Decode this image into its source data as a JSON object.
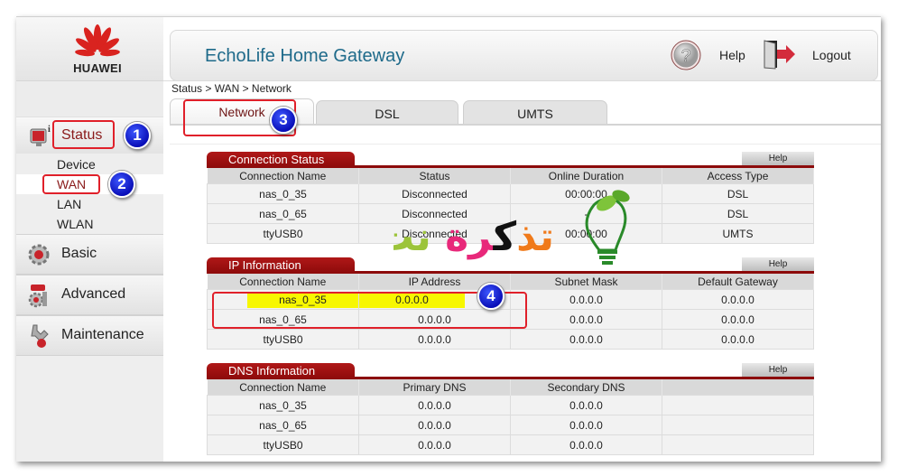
{
  "brand": {
    "logo_text": "HUAWEI",
    "accent_color": "#8c0a0a",
    "title_color": "#1e6a8a"
  },
  "header": {
    "app_title": "EchoLife Home Gateway",
    "help_label": "Help",
    "logout_label": "Logout",
    "help_icon": "question-circle-icon",
    "logout_icon": "door-exit-icon"
  },
  "sidebar": {
    "status": {
      "label": "Status",
      "icon": "monitor-info-icon"
    },
    "status_subitems": [
      {
        "label": "Device"
      },
      {
        "label": "WAN",
        "active": true
      },
      {
        "label": "LAN"
      },
      {
        "label": "WLAN"
      }
    ],
    "items": [
      {
        "label": "Basic",
        "icon": "gear-icon"
      },
      {
        "label": "Advanced",
        "icon": "gears-tools-icon"
      },
      {
        "label": "Maintenance",
        "icon": "wrench-icon"
      }
    ]
  },
  "breadcrumb": "Status > WAN > Network",
  "tabs": [
    {
      "label": "Network",
      "active": true
    },
    {
      "label": "DSL"
    },
    {
      "label": "UMTS"
    }
  ],
  "annotations": {
    "b1": "1",
    "b2": "2",
    "b3": "3",
    "b4": "4"
  },
  "connection_status": {
    "title": "Connection Status",
    "help": "Help",
    "columns": [
      "Connection Name",
      "Status",
      "Online Duration",
      "Access Type"
    ],
    "rows": [
      [
        "nas_0_35",
        "Disconnected",
        "00:00:00",
        "DSL"
      ],
      [
        "nas_0_65",
        "Disconnected",
        "-",
        "DSL"
      ],
      [
        "ttyUSB0",
        "Disconnected",
        "00:00:00",
        "UMTS"
      ]
    ]
  },
  "ip_information": {
    "title": "IP Information",
    "help": "Help",
    "columns": [
      "Connection Name",
      "IP Address",
      "Subnet Mask",
      "Default Gateway"
    ],
    "rows": [
      [
        "nas_0_35",
        "0.0.0.0",
        "0.0.0.0",
        "0.0.0.0"
      ],
      [
        "nas_0_65",
        "0.0.0.0",
        "0.0.0.0",
        "0.0.0.0"
      ],
      [
        "ttyUSB0",
        "0.0.0.0",
        "0.0.0.0",
        "0.0.0.0"
      ]
    ]
  },
  "dns_information": {
    "title": "DNS Information",
    "help": "Help",
    "columns": [
      "Connection Name",
      "Primary DNS",
      "Secondary DNS",
      ""
    ],
    "rows": [
      [
        "nas_0_35",
        "0.0.0.0",
        "0.0.0.0",
        ""
      ],
      [
        "nas_0_65",
        "0.0.0.0",
        "0.0.0.0",
        ""
      ],
      [
        "ttyUSB0",
        "0.0.0.0",
        "0.0.0.0",
        ""
      ]
    ]
  },
  "watermark": {
    "text": "تذكرة نت"
  }
}
